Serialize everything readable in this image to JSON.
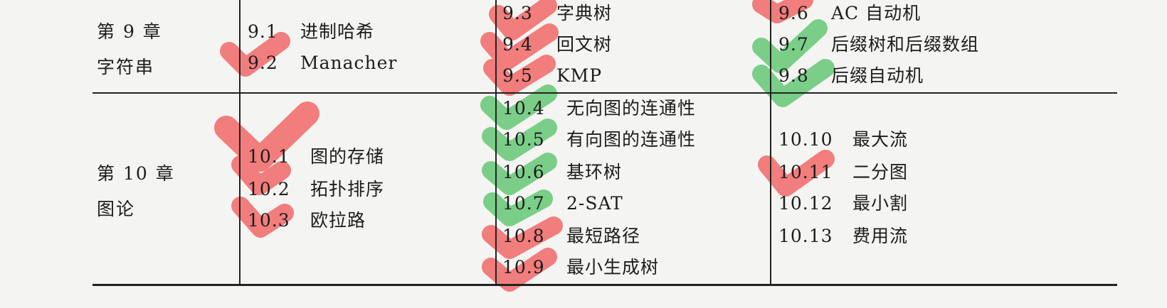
{
  "rows": [
    {
      "chapter": {
        "number_label": "第 9 章",
        "name": "字符串"
      },
      "columns": [
        [
          {
            "num": "9.1",
            "title": "进制哈希"
          },
          {
            "num": "9.2",
            "title": "Manacher"
          }
        ],
        [
          {
            "num": "9.3",
            "title": "字典树"
          },
          {
            "num": "9.4",
            "title": "回文树"
          },
          {
            "num": "9.5",
            "title": "KMP"
          }
        ],
        [
          {
            "num": "9.6",
            "title": "AC 自动机"
          },
          {
            "num": "9.7",
            "title": "后缀树和后缀数组"
          },
          {
            "num": "9.8",
            "title": "后缀自动机"
          }
        ]
      ]
    },
    {
      "chapter": {
        "number_label": "第 10 章",
        "name": "图论"
      },
      "columns": [
        [
          {
            "num": "10.1",
            "title": "图的存储"
          },
          {
            "num": "10.2",
            "title": "拓扑排序"
          },
          {
            "num": "10.3",
            "title": "欧拉路"
          }
        ],
        [
          {
            "num": "10.4",
            "title": "无向图的连通性"
          },
          {
            "num": "10.5",
            "title": "有向图的连通性"
          },
          {
            "num": "10.6",
            "title": "基环树"
          },
          {
            "num": "10.7",
            "title": "2-SAT"
          },
          {
            "num": "10.8",
            "title": "最短路径"
          },
          {
            "num": "10.9",
            "title": "最小生成树"
          }
        ],
        [
          {
            "num": "10.10",
            "title": "最大流"
          },
          {
            "num": "10.11",
            "title": "二分图"
          },
          {
            "num": "10.12",
            "title": "最小割"
          },
          {
            "num": "10.13",
            "title": "费用流"
          }
        ]
      ]
    }
  ],
  "check_colors": {
    "red": "#f05050",
    "green": "#4cc060"
  }
}
